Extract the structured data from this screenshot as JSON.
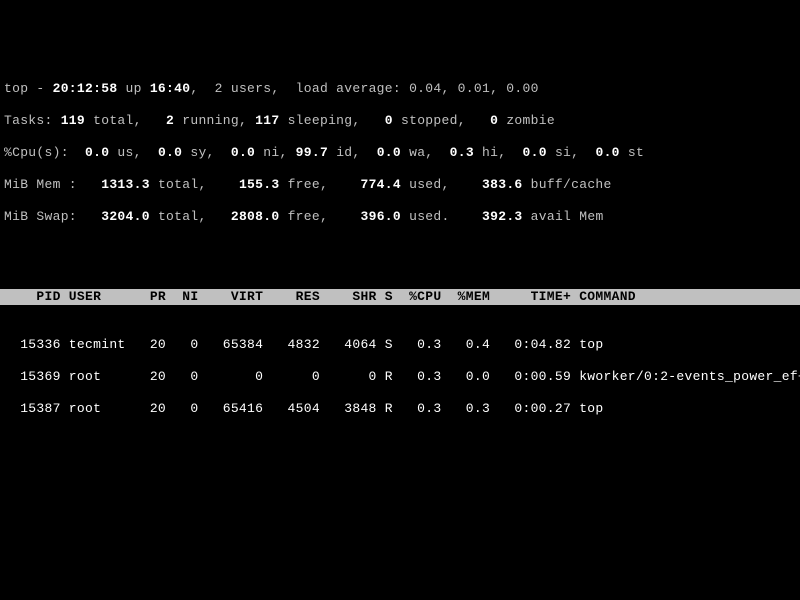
{
  "summary": {
    "line1": {
      "prefix": "top - ",
      "time": "20:12:58",
      "up_label": " up ",
      "uptime": "16:40",
      "users": ",  2 users,  load average: 0.04, 0.01, 0.00"
    },
    "tasks": {
      "label": "Tasks:",
      "total": " 119 ",
      "total_lbl": "total,   ",
      "running": "2 ",
      "running_lbl": "running, ",
      "sleeping": "117 ",
      "sleeping_lbl": "sleeping,   ",
      "stopped": "0 ",
      "stopped_lbl": "stopped,   ",
      "zombie": "0 ",
      "zombie_lbl": "zombie"
    },
    "cpu": {
      "label": "%Cpu(s):  ",
      "us": "0.0 ",
      "us_lbl": "us,  ",
      "sy": "0.0 ",
      "sy_lbl": "sy,  ",
      "ni": "0.0 ",
      "ni_lbl": "ni, ",
      "id": "99.7 ",
      "id_lbl": "id,  ",
      "wa": "0.0 ",
      "wa_lbl": "wa,  ",
      "hi": "0.3 ",
      "hi_lbl": "hi,  ",
      "si": "0.0 ",
      "si_lbl": "si,  ",
      "st": "0.0 ",
      "st_lbl": "st"
    },
    "mem": {
      "label": "MiB Mem :   ",
      "total": "1313.3 ",
      "total_lbl": "total,    ",
      "free": "155.3 ",
      "free_lbl": "free,    ",
      "used": "774.4 ",
      "used_lbl": "used,    ",
      "buff": "383.6 ",
      "buff_lbl": "buff/cache"
    },
    "swap": {
      "label": "MiB Swap:   ",
      "total": "3204.0 ",
      "total_lbl": "total,   ",
      "free": "2808.0 ",
      "free_lbl": "free,    ",
      "used": "396.0 ",
      "used_lbl": "used.    ",
      "avail": "392.3 ",
      "avail_lbl": "avail Mem"
    }
  },
  "columns": "    PID USER      PR  NI    VIRT    RES    SHR S  %CPU  %MEM     TIME+ COMMAND                 ",
  "processes": [
    "  15336 tecmint   20   0   65384   4832   4064 S   0.3   0.4   0:04.82 top",
    "  15369 root      20   0       0      0      0 R   0.3   0.0   0:00.59 kworker/0:2-events_power_ef+",
    "  15387 root      20   0   65416   4504   3848 R   0.3   0.3   0:00.27 top"
  ]
}
